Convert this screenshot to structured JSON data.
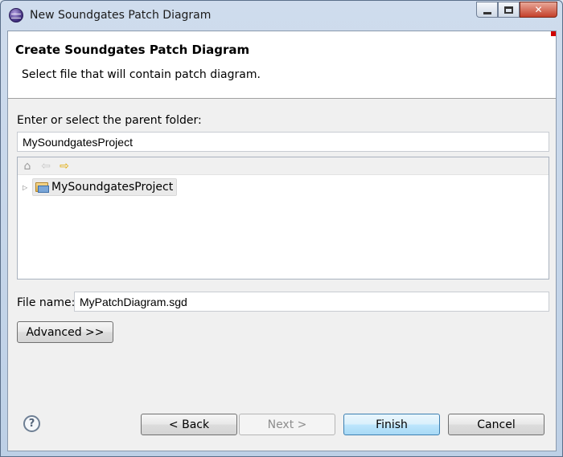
{
  "window": {
    "title": "New Soundgates Patch Diagram"
  },
  "header": {
    "title": "Create Soundgates Patch Diagram",
    "description": "Select file that will contain patch diagram."
  },
  "folder": {
    "label": "Enter or select the parent folder:",
    "value": "MySoundgatesProject"
  },
  "tree": {
    "toolbar_icons": [
      "home-icon",
      "back-arrow-icon",
      "forward-arrow-icon"
    ],
    "items": [
      {
        "label": "MySoundgatesProject",
        "icon": "folder-open-icon"
      }
    ]
  },
  "file": {
    "label": "File name:",
    "value": "MyPatchDiagram.sgd"
  },
  "buttons": {
    "advanced": "Advanced >>",
    "back": "< Back",
    "next": "Next >",
    "finish": "Finish",
    "cancel": "Cancel",
    "help": "?"
  },
  "colors": {
    "accent_default_button": "#3c7fb1",
    "corner_marker": "#d00000"
  }
}
